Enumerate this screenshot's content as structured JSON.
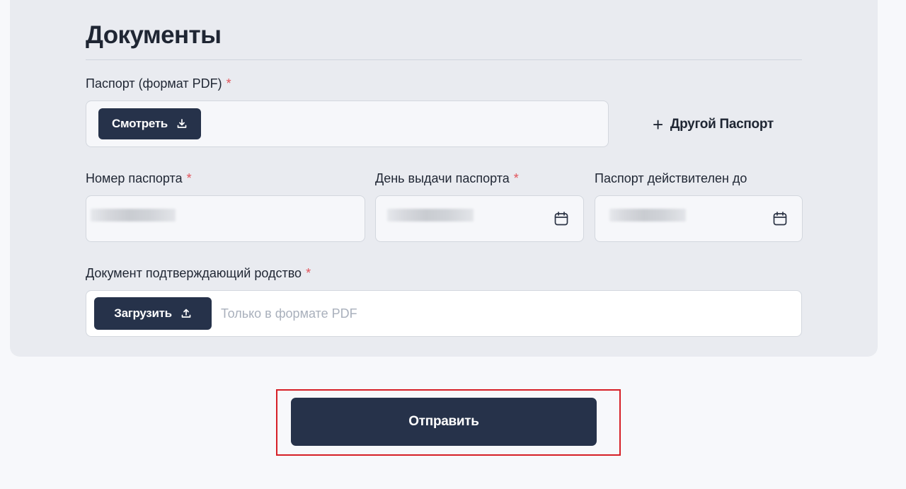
{
  "section": {
    "title": "Документы"
  },
  "passport": {
    "label": "Паспорт (формат PDF)",
    "required_mark": "*",
    "view_button": "Смотреть",
    "add_another": "Другой Паспорт"
  },
  "passport_number": {
    "label": "Номер паспорта",
    "required_mark": "*"
  },
  "issue_date": {
    "label": "День выдачи паспорта",
    "required_mark": "*"
  },
  "valid_until": {
    "label": "Паспорт действителен до"
  },
  "kinship_document": {
    "label": "Документ подтверждающий родство",
    "required_mark": "*",
    "upload_button": "Загрузить",
    "placeholder": "Только в формате PDF"
  },
  "submit": {
    "label": "Отправить"
  },
  "icons": {
    "download": "download-icon",
    "upload": "upload-icon",
    "calendar": "calendar-icon",
    "plus": "plus-icon"
  },
  "colors": {
    "dark_button": "#26324a",
    "card_bg": "#e9ebf0",
    "required": "#e2535a",
    "highlight": "#d61f26"
  }
}
